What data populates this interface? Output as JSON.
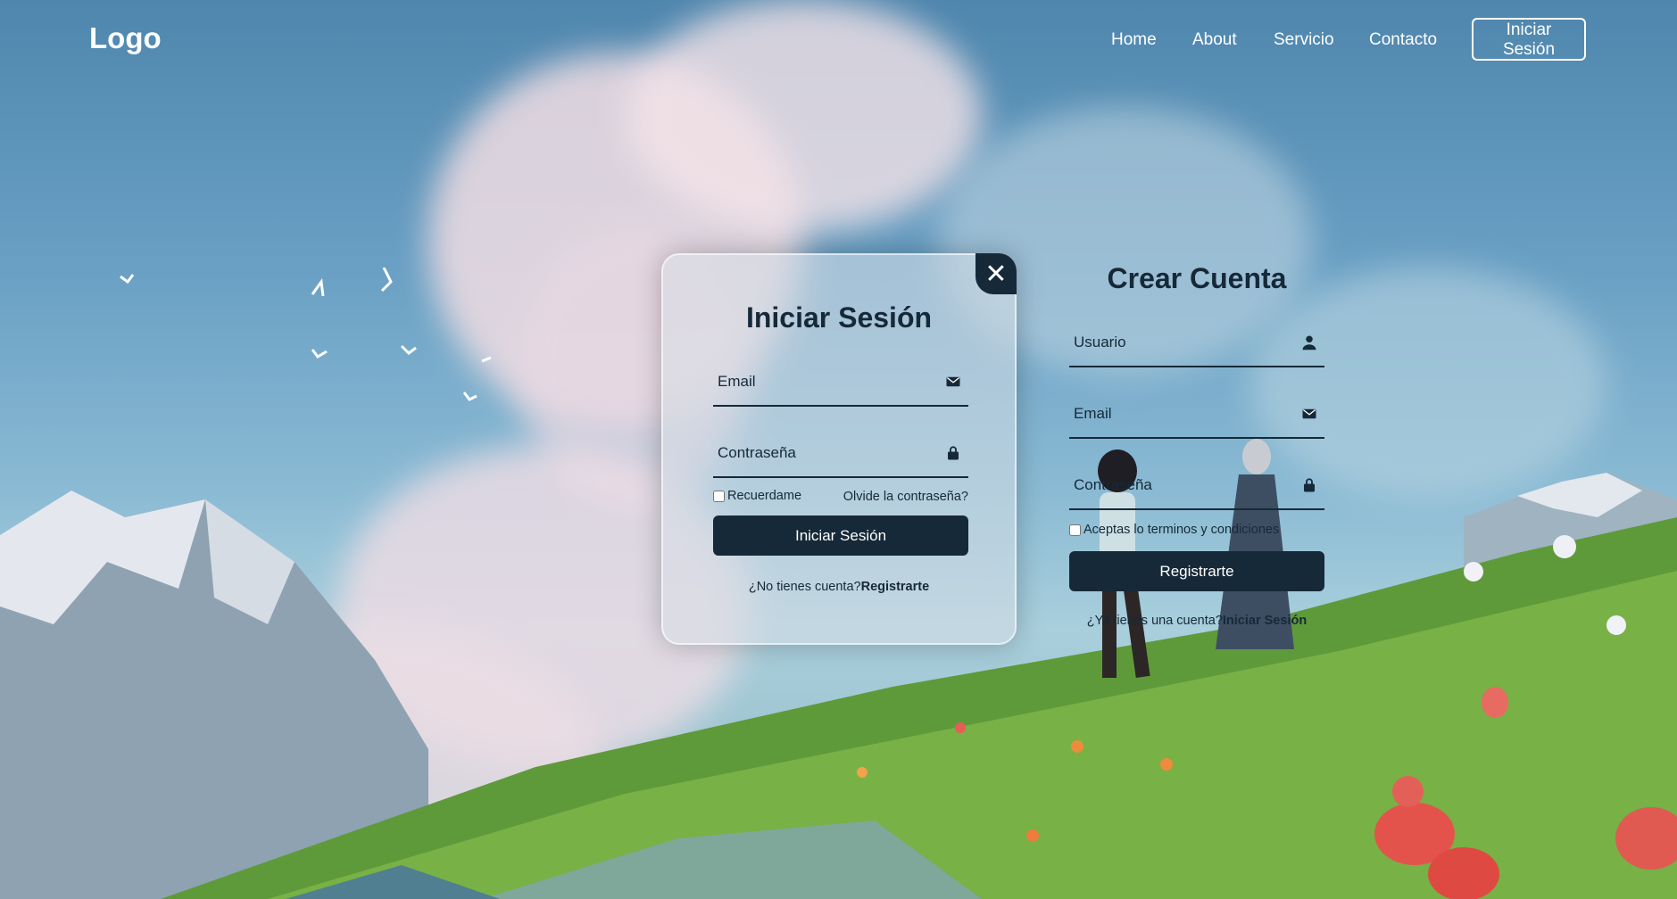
{
  "header": {
    "logo": "Logo",
    "nav": [
      "Home",
      "About",
      "Servicio",
      "Contacto"
    ],
    "login_button": "Iniciar Sesión"
  },
  "login": {
    "title": "Iniciar Sesión",
    "email_placeholder": "Email",
    "password_placeholder": "Contraseña",
    "remember_label": "Recuerdame",
    "forgot_link": "Olvide la contraseña?",
    "submit_label": "Iniciar Sesión",
    "switch_prefix": "¿No tienes cuenta?",
    "switch_link": "Registrarte",
    "close_icon": "close-icon"
  },
  "register": {
    "title": "Crear Cuenta",
    "username_placeholder": "Usuario",
    "email_placeholder": "Email",
    "password_placeholder": "Contraseña",
    "terms_label": "Aceptas lo terminos y condiciones",
    "submit_label": "Registrarte",
    "switch_prefix": "¿Ya tienes una cuenta?",
    "switch_link": "Iniciar Sesión"
  },
  "colors": {
    "primary": "#162938",
    "text_light": "#ffffff"
  },
  "icons": {
    "email": "mail-icon",
    "password": "lock-icon",
    "username": "person-icon"
  }
}
